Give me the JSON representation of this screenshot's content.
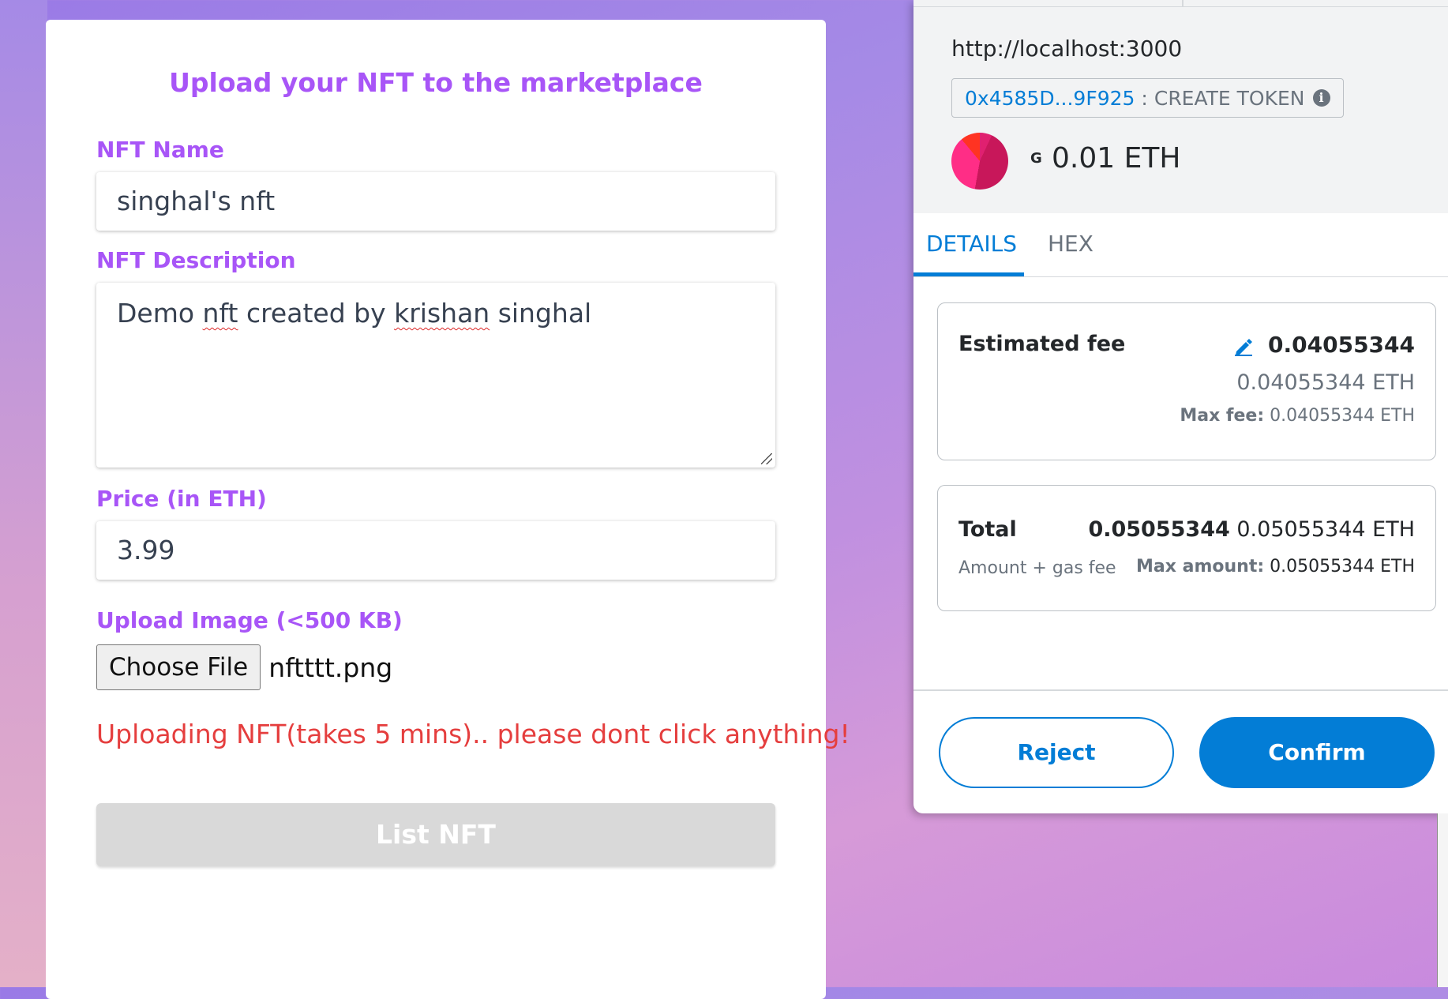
{
  "form": {
    "title": "Upload your NFT to the marketplace",
    "name_label": "NFT Name",
    "name_value": "singhal's nft",
    "description_label": "NFT Description",
    "description_parts": [
      "Demo ",
      "nft",
      " created by ",
      "krishan",
      " singhal"
    ],
    "price_label": "Price (in ETH)",
    "price_value": "3.99",
    "image_label": "Upload Image (<500 KB)",
    "choose_file_label": "Choose File",
    "file_name": "nftttt.png",
    "status_message": "Uploading NFT(takes 5 mins).. please dont click anything!",
    "submit_label": "List NFT"
  },
  "metamask": {
    "origin": "http://localhost:3000",
    "contract_address": "0x4585D...9F925",
    "separator": ":",
    "method": "CREATE TOKEN",
    "info_glyph": "i",
    "network_letter": "G",
    "value": "0.01 ETH",
    "tabs": [
      "DETAILS",
      "HEX"
    ],
    "estimated_fee": {
      "label": "Estimated fee",
      "primary": "0.04055344",
      "secondary": "0.04055344 ETH",
      "max_label": "Max fee:",
      "max_value": "0.04055344 ETH"
    },
    "total": {
      "label": "Total",
      "primary": "0.05055344",
      "secondary": "0.05055344 ETH",
      "sublabel": "Amount + gas fee",
      "max_label": "Max amount:",
      "max_value": "0.05055344 ETH"
    },
    "reject_label": "Reject",
    "confirm_label": "Confirm"
  },
  "colors": {
    "form_accent": "#a855f7",
    "error_text": "#e53e3e",
    "metamask_blue": "#037dd6"
  },
  "icons": [
    "info-icon",
    "pencil-edit-icon",
    "account-identicon"
  ]
}
